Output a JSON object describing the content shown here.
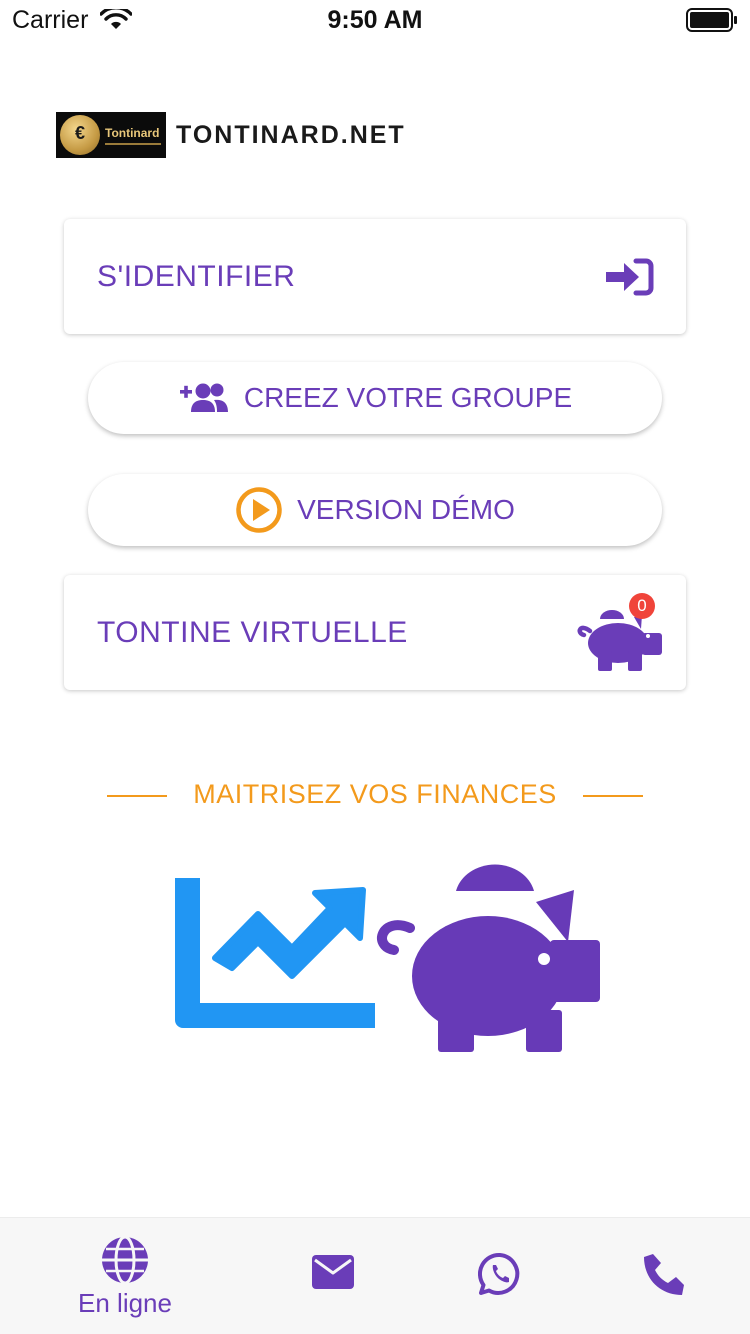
{
  "status_bar": {
    "carrier": "Carrier",
    "time": "9:50 AM"
  },
  "brand": {
    "logo_text": "Tontinard",
    "logo_symbol": "€",
    "name": "TONTINARD.NET"
  },
  "actions": {
    "login_label": "S'IDENTIFIER",
    "login_icon": "sign-in-icon",
    "create_group_label": "CREEZ VOTRE GROUPE",
    "create_group_icon": "add-group-icon",
    "demo_label": "VERSION DÉMO",
    "demo_icon": "play-circle-icon",
    "virtual_label": "TONTINE VIRTUELLE",
    "virtual_icon": "piggy-bank-icon",
    "virtual_badge": "0"
  },
  "slogan": "MAITRISEZ VOS FINANCES",
  "hero": {
    "icons": [
      "chart-line-icon",
      "piggy-bank-icon"
    ]
  },
  "tab_bar": {
    "items": [
      {
        "icon": "globe-icon",
        "label": "En ligne"
      },
      {
        "icon": "envelope-icon",
        "label": ""
      },
      {
        "icon": "whatsapp-icon",
        "label": ""
      },
      {
        "icon": "phone-icon",
        "label": ""
      }
    ]
  },
  "colors": {
    "primary": "#6a3db8",
    "accent": "#f39a1c",
    "chart_blue": "#2196f3",
    "badge_red": "#f0443a"
  }
}
